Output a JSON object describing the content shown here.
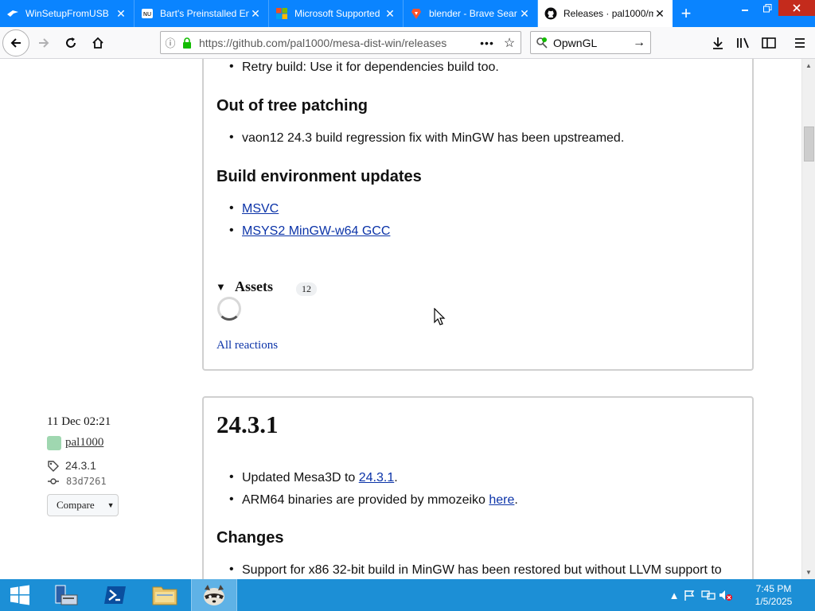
{
  "browser": {
    "tabs": [
      {
        "title": "WinSetupFromUSB",
        "icon": "winsetup-favicon"
      },
      {
        "title": "Bart's Preinstalled En",
        "icon": "pe-favicon"
      },
      {
        "title": "Microsoft Supported",
        "icon": "microsoft-favicon"
      },
      {
        "title": "blender - Brave Sear",
        "icon": "brave-favicon"
      },
      {
        "title": "Releases · pal1000/m",
        "icon": "github-favicon",
        "active": true
      }
    ],
    "new_tab_glyph": "+",
    "url": "https://github.com/pal1000/mesa-dist-win/releases",
    "search_value": "OpwnGL",
    "close_glyph": "✕"
  },
  "release_prev": {
    "retry_item": "Retry build: Use it for dependencies build too.",
    "oot_heading": "Out of tree patching",
    "oot_item": "vaon12 24.3 build regression fix with MinGW has been upstreamed.",
    "env_heading": "Build environment updates",
    "env_links": [
      "MSVC",
      "MSYS2 MinGW-w64 GCC"
    ],
    "assets_label": "Assets",
    "assets_count": "12",
    "reactions_label": "All reactions"
  },
  "release_next": {
    "date": "11 Dec 02:21",
    "author": "pal1000",
    "tag": "24.3.1",
    "commit": "83d7261",
    "compare_label": "Compare",
    "version": "24.3.1",
    "item1_prefix": "Updated Mesa3D to ",
    "item1_link": "24.3.1",
    "item1_suffix": ".",
    "item2_prefix": "ARM64 binaries are provided by mmozeiko ",
    "item2_link": "here",
    "item2_suffix": ".",
    "changes_heading": "Changes",
    "change_item": "Support for x86 32-bit build in MinGW has been restored but without LLVM support to"
  },
  "taskbar": {
    "time": "7:45 PM",
    "date": "1/5/2025"
  }
}
